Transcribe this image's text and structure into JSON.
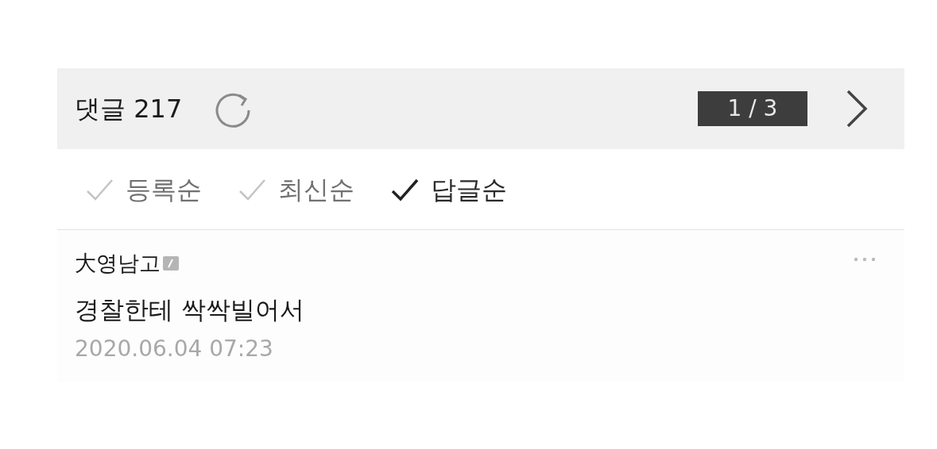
{
  "header": {
    "title": "댓글 217",
    "pager": "1 / 3"
  },
  "sort_options": [
    {
      "label": "등록순",
      "selected": false
    },
    {
      "label": "최신순",
      "selected": false
    },
    {
      "label": "답글순",
      "selected": true
    }
  ],
  "comments": [
    {
      "author": "大영남고",
      "text": "경찰한테 싹싹빌어서",
      "date": "2020.06.04 07:23"
    }
  ]
}
